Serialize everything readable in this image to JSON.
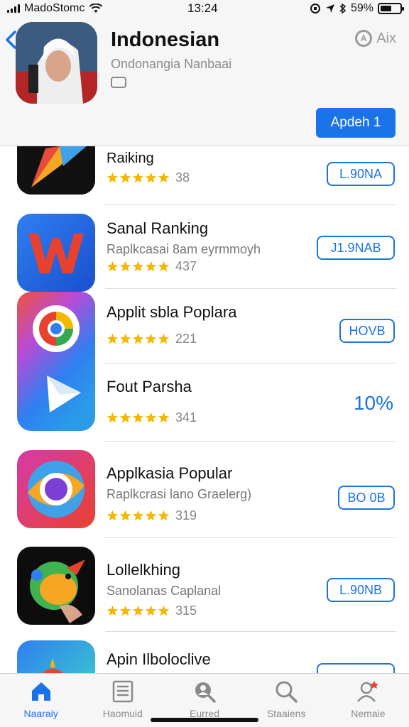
{
  "status": {
    "carrier": "MadoStomc",
    "time": "13:24",
    "battery": "59%",
    "battery_level": 0.59
  },
  "header": {
    "title": "Indonesian",
    "subtitle": "Ondonangia Nanbaai",
    "action_label": "Aix",
    "button_label": "Apdeh 1"
  },
  "apps": [
    {
      "name": "Raiking",
      "description": "",
      "rating": "38",
      "button": "L.90NA"
    },
    {
      "name": "Sanal Ranking",
      "description": "Raplkcasai 8am eyrmmoyh",
      "rating": "437",
      "button": "J1.9NAB"
    },
    {
      "name": "Applit sbla Poplara",
      "description": "",
      "rating": "221",
      "button": "HOVB"
    },
    {
      "name": "Fout Parsha",
      "description": "",
      "rating": "341",
      "button": "10%"
    },
    {
      "name": "Applkasia Popular",
      "description": "Raplkcrasi lano Graelerg)",
      "rating": "319",
      "button": "BO 0B"
    },
    {
      "name": "Lollelkhing",
      "description": "Sanolanas Caplanal",
      "rating": "315",
      "button": "L.90NB"
    },
    {
      "name": "Apin Ilboloclive",
      "description": "",
      "rating": "",
      "button": ""
    }
  ],
  "tabs": [
    {
      "label": "Naaraiy",
      "icon": "home-icon"
    },
    {
      "label": "Haomuid",
      "icon": "list-icon"
    },
    {
      "label": "Eurred",
      "icon": "search-person-icon"
    },
    {
      "label": "Staaiens",
      "icon": "search-icon"
    },
    {
      "label": "Nemaie",
      "icon": "profile-icon"
    }
  ],
  "colors": {
    "accent": "#1a73e8",
    "star": "#f5b800",
    "background": "#ffffff",
    "bar": "#f6f6f6"
  }
}
